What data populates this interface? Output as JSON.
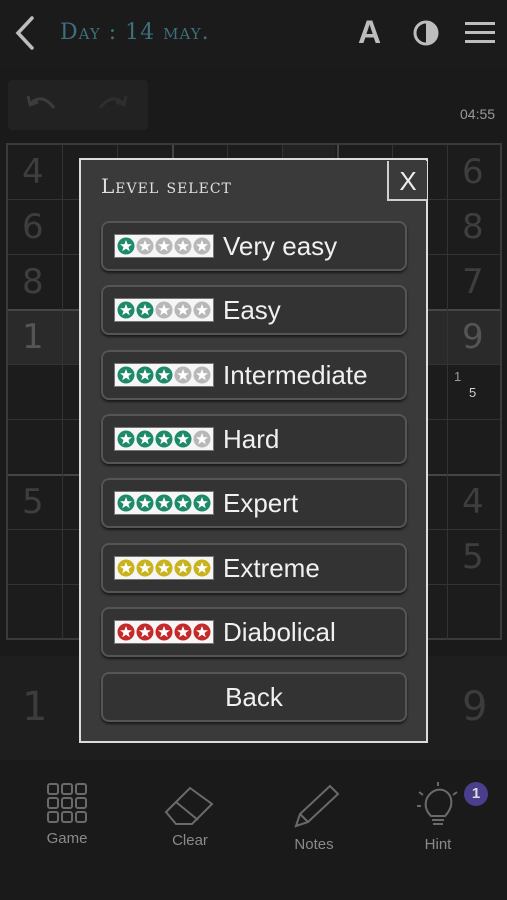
{
  "header": {
    "title": "Day : 14 may.",
    "font_button": "A"
  },
  "timer": "04:55",
  "grid_visible_numbers": {
    "row1_left": "4",
    "row1_right": "6",
    "row2_left": "6",
    "row2_right": "8",
    "row3_left": "8",
    "row3_right": "7",
    "row4_left": "1",
    "row4_right": "9",
    "row5_note_a": "1",
    "row5_note_b": "5",
    "row7_left": "5",
    "row7_right": "4",
    "row8_right": "5"
  },
  "numpad": {
    "left": "1",
    "right": "9"
  },
  "dialog": {
    "title": "Level select",
    "close_label": "X",
    "levels": [
      {
        "label": "Very easy",
        "filled": 1,
        "color": "#1f8a6a"
      },
      {
        "label": "Easy",
        "filled": 2,
        "color": "#1f8a6a"
      },
      {
        "label": "Intermediate",
        "filled": 3,
        "color": "#1f8a6a"
      },
      {
        "label": "Hard",
        "filled": 4,
        "color": "#1f8a6a"
      },
      {
        "label": "Expert",
        "filled": 5,
        "color": "#1f8a6a"
      },
      {
        "label": "Extreme",
        "filled": 5,
        "color": "#c9b21c"
      },
      {
        "label": "Diabolical",
        "filled": 5,
        "color": "#c42a2a"
      }
    ],
    "back_label": "Back"
  },
  "toolbar": {
    "game": "Game",
    "clear": "Clear",
    "notes": "Notes",
    "hint": "Hint",
    "hint_badge": "1"
  },
  "colors": {
    "title_accent": "#3d6f7c",
    "empty_star": "#b8b8b8",
    "hint_badge": "#4a3f8c"
  },
  "icons": [
    "back-arrow-icon",
    "font-size-icon",
    "contrast-icon",
    "menu-icon",
    "undo-icon",
    "redo-icon",
    "grid-icon",
    "eraser-icon",
    "pencil-icon",
    "lightbulb-icon",
    "star-icon"
  ]
}
